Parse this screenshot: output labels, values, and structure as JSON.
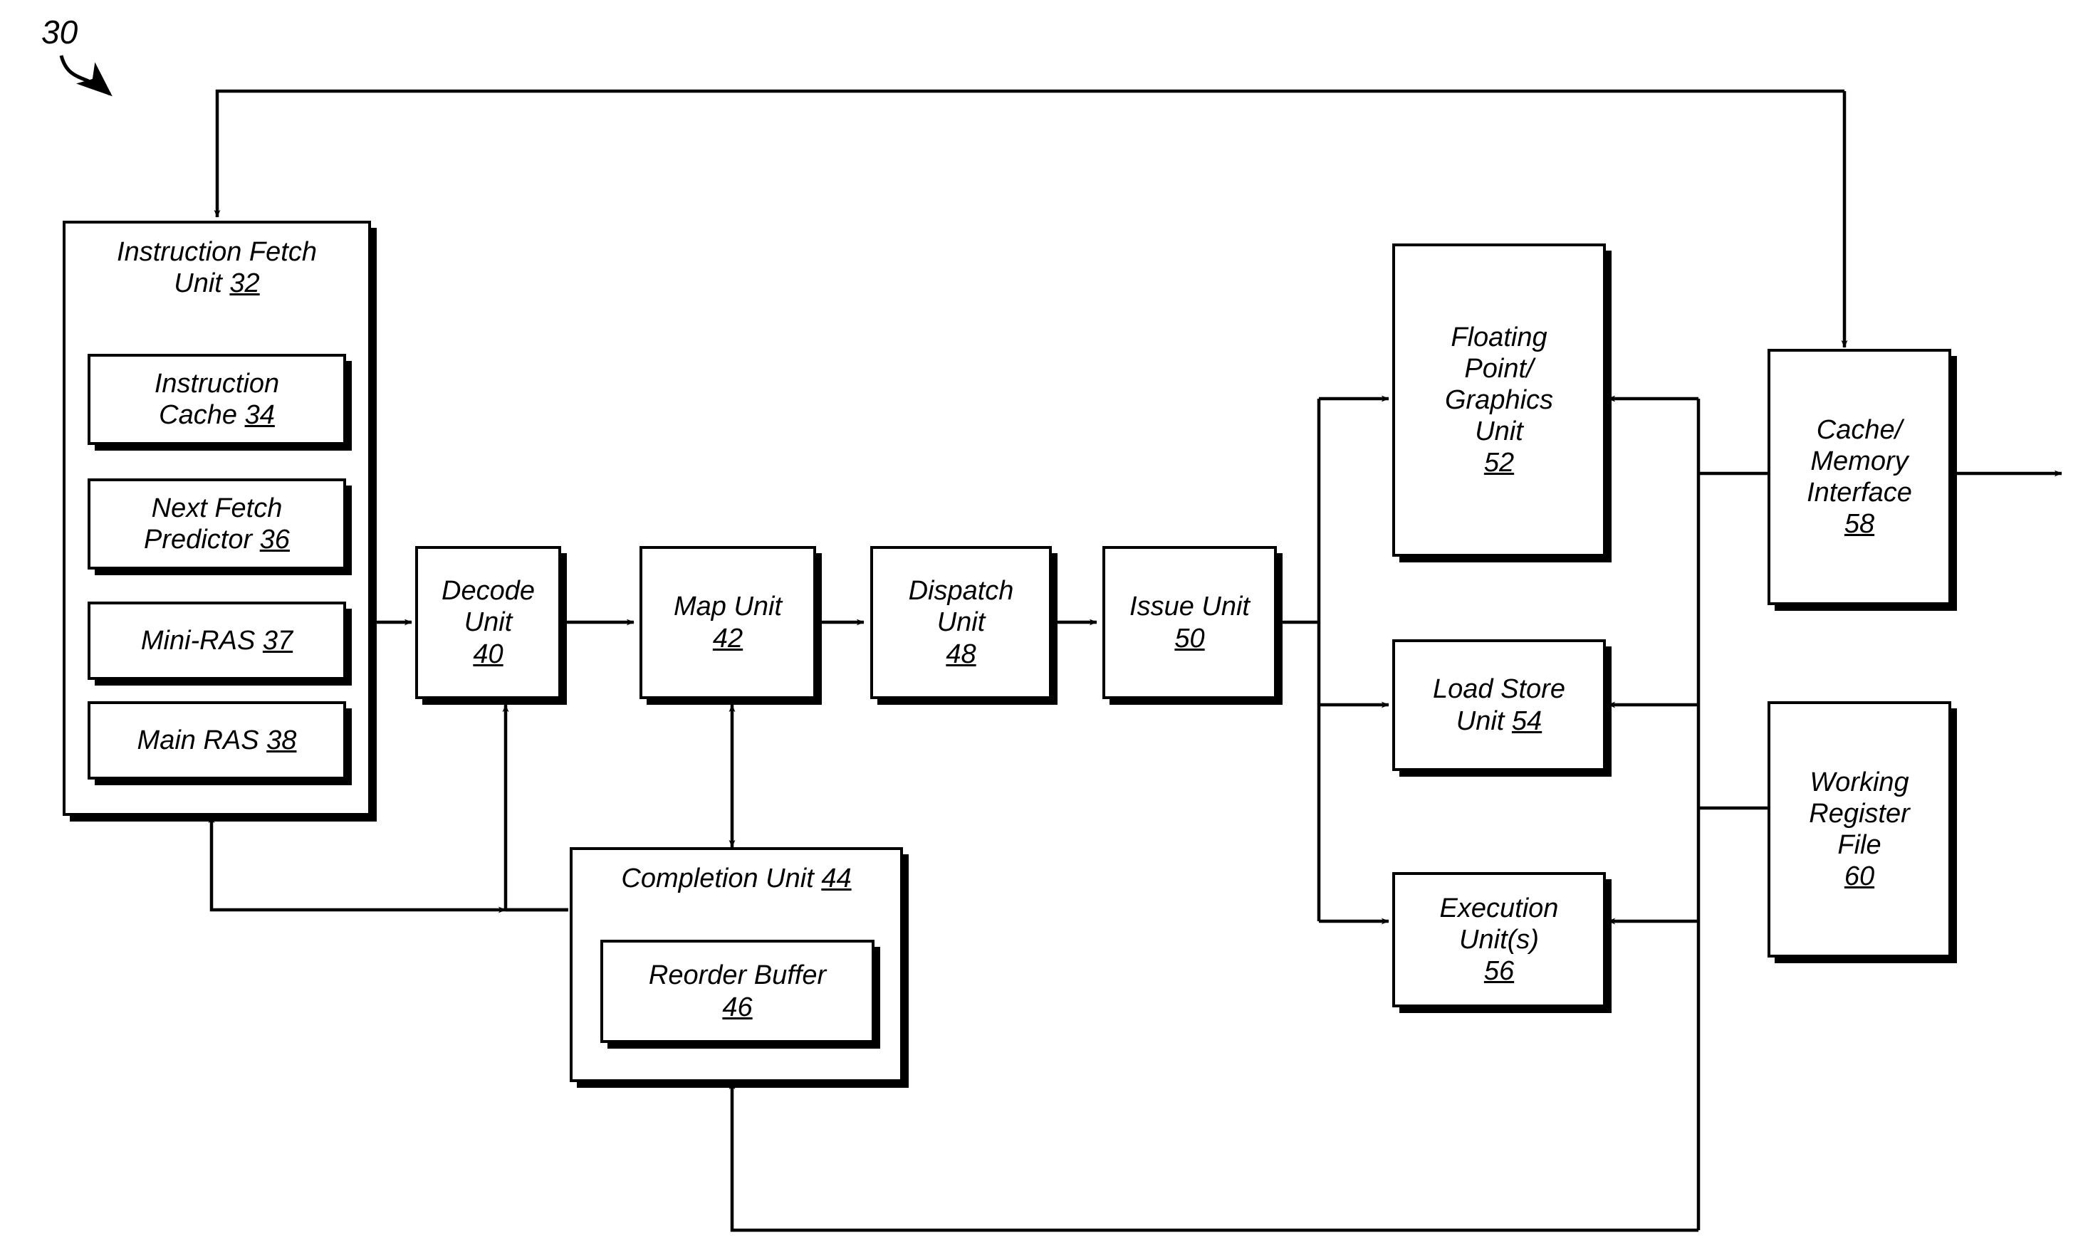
{
  "figure": {
    "reference_numeral": "30",
    "type": "processor-block-diagram"
  },
  "blocks": {
    "instruction_fetch_unit": {
      "text": "Instruction Fetch\nUnit ",
      "ref": "32"
    },
    "instruction_cache": {
      "text": "Instruction\nCache ",
      "ref": "34"
    },
    "next_fetch_predictor": {
      "text": "Next Fetch\nPredictor ",
      "ref": "36"
    },
    "mini_ras": {
      "text": "Mini-RAS ",
      "ref": "37"
    },
    "main_ras": {
      "text": "Main RAS ",
      "ref": "38"
    },
    "decode_unit": {
      "text": "Decode\nUnit\n",
      "ref": "40"
    },
    "map_unit": {
      "text": "Map Unit\n",
      "ref": "42"
    },
    "completion_unit": {
      "text": "Completion Unit ",
      "ref": "44"
    },
    "reorder_buffer": {
      "text": "Reorder Buffer\n",
      "ref": "46"
    },
    "dispatch_unit": {
      "text": "Dispatch\nUnit\n",
      "ref": "48"
    },
    "issue_unit": {
      "text": "Issue Unit\n",
      "ref": "50"
    },
    "fp_graphics_unit": {
      "text": "Floating\nPoint/\nGraphics\nUnit\n",
      "ref": "52"
    },
    "load_store_unit": {
      "text": "Load Store\nUnit ",
      "ref": "54"
    },
    "execution_units": {
      "text": "Execution\nUnit(s)\n",
      "ref": "56"
    },
    "cache_memory_interface": {
      "text": "Cache/\nMemory\nInterface\n",
      "ref": "58"
    },
    "working_register_file": {
      "text": "Working\nRegister\nFile\n",
      "ref": "60"
    }
  },
  "colors": {
    "line": "#000000",
    "fill": "#ffffff"
  }
}
